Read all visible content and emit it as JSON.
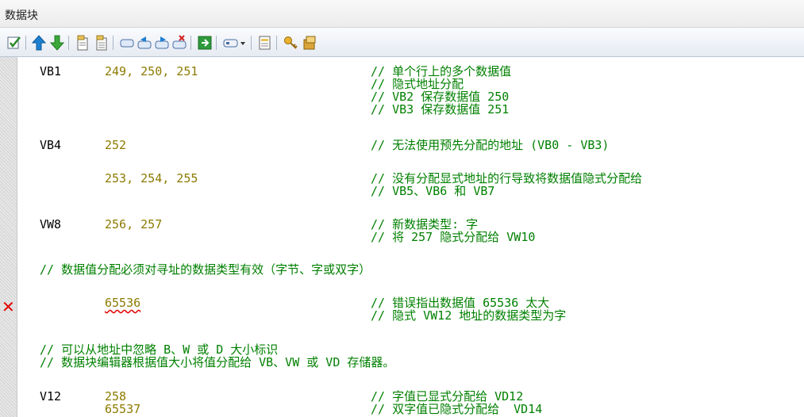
{
  "window": {
    "title": "数据块"
  },
  "toolbar": {
    "buttons": [
      {
        "name": "compile-check-icon"
      },
      {
        "name": "arrow-up-icon"
      },
      {
        "name": "arrow-down-icon"
      },
      {
        "name": "insert-block-icon"
      },
      {
        "name": "delete-block-icon"
      },
      {
        "name": "bookmark-icon"
      },
      {
        "name": "previous-bookmark-icon"
      },
      {
        "name": "next-bookmark-icon"
      },
      {
        "name": "remove-bookmarks-icon"
      },
      {
        "name": "goto-icon"
      },
      {
        "name": "view-dropdown-icon"
      },
      {
        "name": "properties-icon"
      },
      {
        "name": "protect-icon"
      },
      {
        "name": "library-icon"
      }
    ]
  },
  "editor": {
    "lines": {
      "l1": {
        "addr": "VB1",
        "vals": "249, 250, 251",
        "comment": "// 单个行上的多个数据值"
      },
      "l2": {
        "comment": "// 隐式地址分配"
      },
      "l3": {
        "comment": "// VB2 保存数据值 250"
      },
      "l4": {
        "comment": "// VB3 保存数据值 251"
      },
      "l5": {
        "addr": "VB4",
        "vals": "252",
        "comment": "// 无法使用预先分配的地址 (VB0 - VB3)"
      },
      "l6": {
        "vals": "253, 254, 255",
        "comment": "// 没有分配显式地址的行导致将数据值隐式分配给"
      },
      "l7": {
        "comment": "// VB5、VB6 和 VB7"
      },
      "l8": {
        "addr": "VW8",
        "vals": "256, 257",
        "comment": "// 新数据类型: 字"
      },
      "l9": {
        "comment": "// 将 257 隐式分配给 VW10"
      },
      "l10": {
        "comment": "// 数据值分配必须对寻址的数据类型有效（字节、字或双字）"
      },
      "l11": {
        "error_mark": "✕",
        "vals": "65536",
        "comment": "// 错误指出数据值 65536 太大"
      },
      "l12": {
        "comment": "// 隐式 VW12 地址的数据类型为字"
      },
      "l13": {
        "comment": "// 可以从地址中忽略 B、W 或 D 大小标识"
      },
      "l14": {
        "comment": "// 数据块编辑器根据值大小将值分配给 VB、VW 或 VD 存储器。"
      },
      "l15": {
        "addr": "V12",
        "vals": "258",
        "comment": "// 字值已显式分配给 VD12"
      },
      "l16": {
        "vals": "65537",
        "comment": "// 双字值已隐式分配给  VD14"
      }
    }
  },
  "colors": {
    "address": "#000000",
    "value": "#8c7a00",
    "comment": "#008000",
    "error": "#e00000"
  }
}
